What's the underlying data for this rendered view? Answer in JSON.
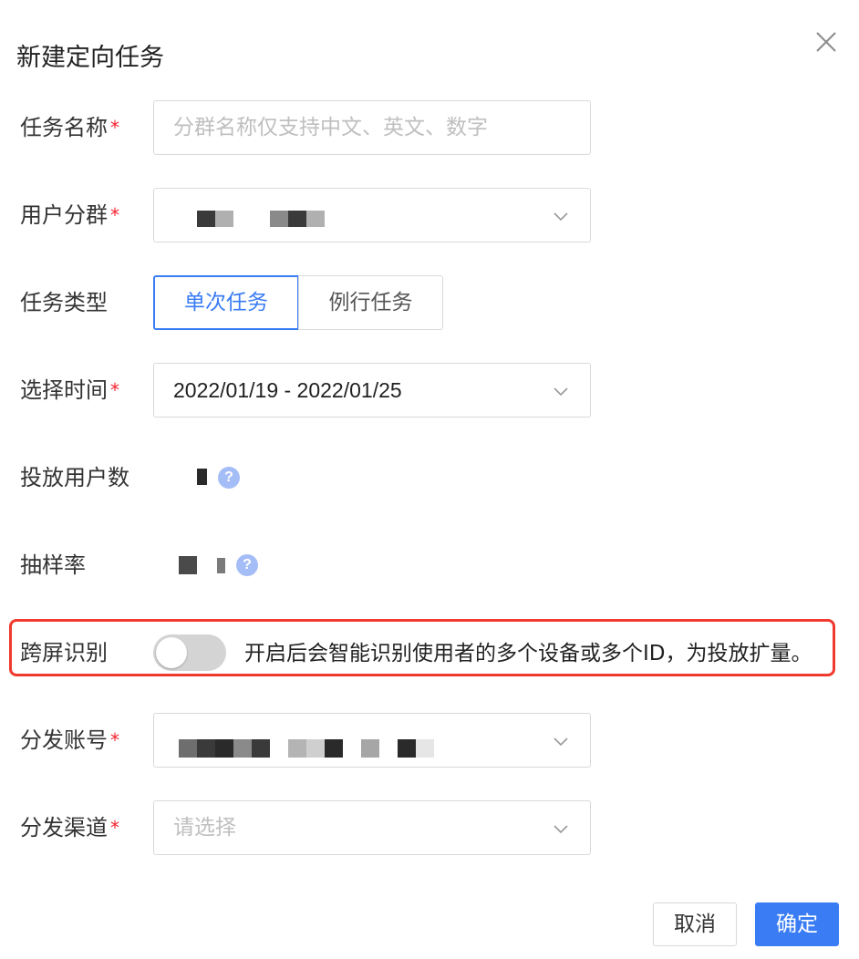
{
  "dialog": {
    "title": "新建定向任务",
    "close_icon": "close-icon"
  },
  "form": {
    "task_name": {
      "label": "任务名称",
      "required_mark": "*",
      "placeholder": "分群名称仅支持中文、英文、数字"
    },
    "user_group": {
      "label": "用户分群",
      "required_mark": "*",
      "icon": "chevron-down-icon"
    },
    "task_type": {
      "label": "任务类型",
      "options": [
        "单次任务",
        "例行任务"
      ],
      "selected": "单次任务"
    },
    "time_range": {
      "label": "选择时间",
      "required_mark": "*",
      "value": "2022/01/19 - 2022/01/25",
      "icon": "chevron-down-icon"
    },
    "target_users": {
      "label": "投放用户数",
      "help_icon": "question-circle-icon",
      "help_glyph": "?"
    },
    "sampling_rate": {
      "label": "抽样率",
      "help_icon": "question-circle-icon",
      "help_glyph": "?"
    },
    "cross_screen": {
      "label": "跨屏识别",
      "enabled": false,
      "description": "开启后会智能识别使用者的多个设备或多个ID，为投放扩量。"
    },
    "distribution_account": {
      "label": "分发账号",
      "required_mark": "*",
      "icon": "chevron-down-icon"
    },
    "distribution_channel": {
      "label": "分发渠道",
      "required_mark": "*",
      "placeholder": "请选择",
      "icon": "chevron-down-icon"
    }
  },
  "footer": {
    "cancel_label": "取消",
    "confirm_label": "确定"
  },
  "colors": {
    "primary": "#3a7cf4",
    "required": "#f5222d",
    "highlight_border": "#f03a2e",
    "help_icon": "#a5bdf7",
    "toggle_off": "#d4d4d4"
  }
}
